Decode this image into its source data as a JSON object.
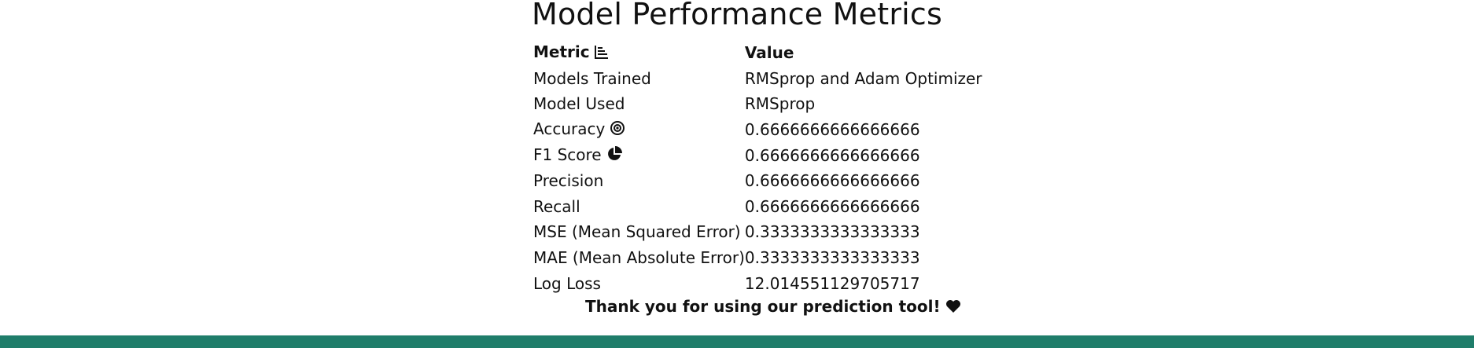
{
  "page": {
    "title": "Model Performance Metrics"
  },
  "table": {
    "headers": {
      "metric": "Metric",
      "value": "Value",
      "metric_icon": "bar-chart-icon"
    },
    "rows": [
      {
        "metric": "Models Trained",
        "value": "RMSprop and Adam Optimizer"
      },
      {
        "metric": "Model Used",
        "value": "RMSprop"
      },
      {
        "metric": "Accuracy",
        "value": "0.6666666666666666",
        "icon": "target-icon"
      },
      {
        "metric": "F1 Score",
        "value": "0.6666666666666666",
        "icon": "pie-chart-icon"
      },
      {
        "metric": "Precision",
        "value": "0.6666666666666666"
      },
      {
        "metric": "Recall",
        "value": "0.6666666666666666"
      },
      {
        "metric": "MSE (Mean Squared Error)",
        "value": "0.3333333333333333"
      },
      {
        "metric": "MAE (Mean Absolute Error)",
        "value": "0.3333333333333333"
      },
      {
        "metric": "Log Loss",
        "value": "12.014551129705717"
      }
    ]
  },
  "footer": {
    "thanks": "Thank you for using our prediction tool!",
    "thanks_icon": "heart-icon",
    "bar_color": "#1f7d6a"
  }
}
